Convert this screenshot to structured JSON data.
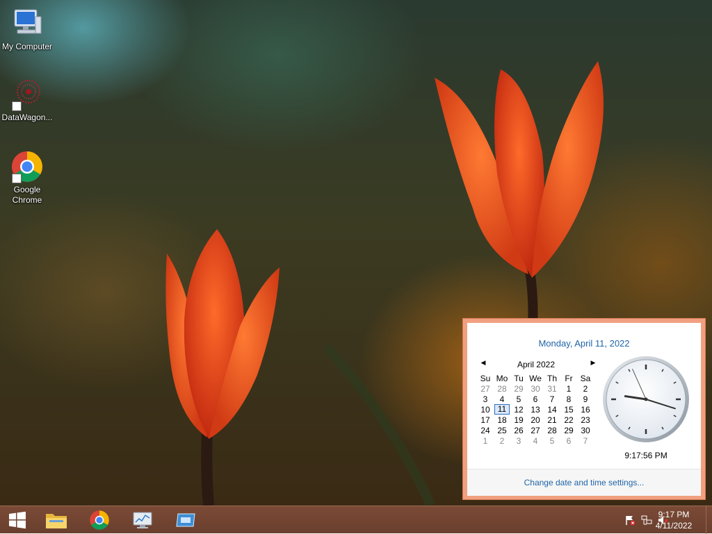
{
  "desktop": {
    "icons": [
      {
        "label": "My Computer",
        "icon": "computer-icon"
      },
      {
        "label": "DataWagon...",
        "icon": "datawagon-icon"
      },
      {
        "label": "Google Chrome",
        "icon": "chrome-icon"
      }
    ]
  },
  "taskbar": {
    "buttons": [
      {
        "name": "start-button",
        "icon": "windows-logo-icon"
      },
      {
        "name": "file-explorer-button",
        "icon": "folder-icon"
      },
      {
        "name": "chrome-button",
        "icon": "chrome-icon"
      },
      {
        "name": "task-manager-button",
        "icon": "monitor-chart-icon"
      },
      {
        "name": "remote-desktop-button",
        "icon": "window-icon"
      }
    ],
    "tray": {
      "icons": [
        "action-center-flag-icon",
        "network-icon",
        "volume-muted-icon"
      ],
      "time": "9:17 PM",
      "date": "4/11/2022"
    }
  },
  "calendar_flyout": {
    "long_date": "Monday, April 11, 2022",
    "month_title": "April 2022",
    "prev_glyph": "◀",
    "next_glyph": "▶",
    "weekdays": [
      "Su",
      "Mo",
      "Tu",
      "We",
      "Th",
      "Fr",
      "Sa"
    ],
    "weeks": [
      [
        "27",
        "28",
        "29",
        "30",
        "31",
        "1",
        "2"
      ],
      [
        "3",
        "4",
        "5",
        "6",
        "7",
        "8",
        "9"
      ],
      [
        "10",
        "11",
        "12",
        "13",
        "14",
        "15",
        "16"
      ],
      [
        "17",
        "18",
        "19",
        "20",
        "21",
        "22",
        "23"
      ],
      [
        "24",
        "25",
        "26",
        "27",
        "28",
        "29",
        "30"
      ],
      [
        "1",
        "2",
        "3",
        "4",
        "5",
        "6",
        "7"
      ]
    ],
    "other_month_first_week_count": 5,
    "other_month_last_week_count": 7,
    "today": "11",
    "digital_time": "9:17:56 PM",
    "clock": {
      "hour": 9,
      "minute": 17,
      "second": 56
    },
    "change_link": "Change date and time settings..."
  }
}
